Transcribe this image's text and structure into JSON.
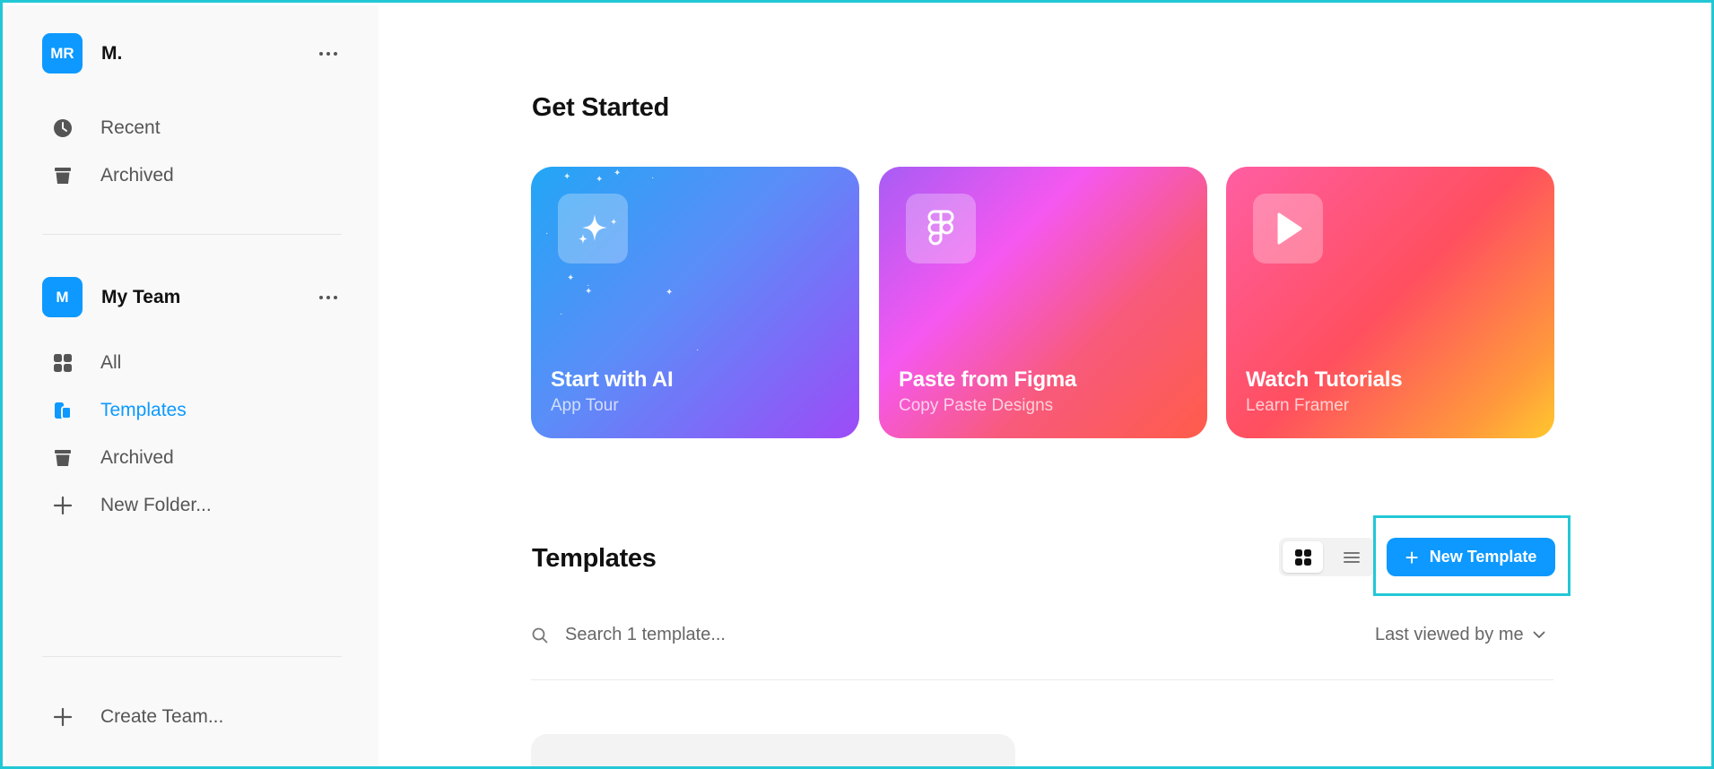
{
  "sidebar": {
    "workspace": {
      "avatar": "MR",
      "name": "M."
    },
    "personal_items": [
      {
        "label": "Recent",
        "icon": "clock-icon"
      },
      {
        "label": "Archived",
        "icon": "archive-icon"
      }
    ],
    "team": {
      "avatar": "M",
      "name": "My Team"
    },
    "team_items": [
      {
        "label": "All",
        "icon": "grid-icon"
      },
      {
        "label": "Templates",
        "icon": "templates-icon",
        "active": true
      },
      {
        "label": "Archived",
        "icon": "archive-icon"
      },
      {
        "label": "New Folder...",
        "icon": "plus-icon"
      }
    ],
    "create_team": "Create Team..."
  },
  "main": {
    "get_started_title": "Get Started",
    "cards": [
      {
        "title": "Start with AI",
        "subtitle": "App Tour",
        "icon": "sparkle-icon"
      },
      {
        "title": "Paste from Figma",
        "subtitle": "Copy Paste Designs",
        "icon": "figma-icon"
      },
      {
        "title": "Watch Tutorials",
        "subtitle": "Learn Framer",
        "icon": "play-icon"
      }
    ],
    "templates_title": "Templates",
    "new_template_label": "New Template",
    "search_placeholder": "Search 1 template...",
    "sort_label": "Last viewed by me"
  },
  "colors": {
    "accent": "#0d99ff",
    "highlight": "#22c7d6",
    "sidebar_bg": "#f9f9f9"
  }
}
